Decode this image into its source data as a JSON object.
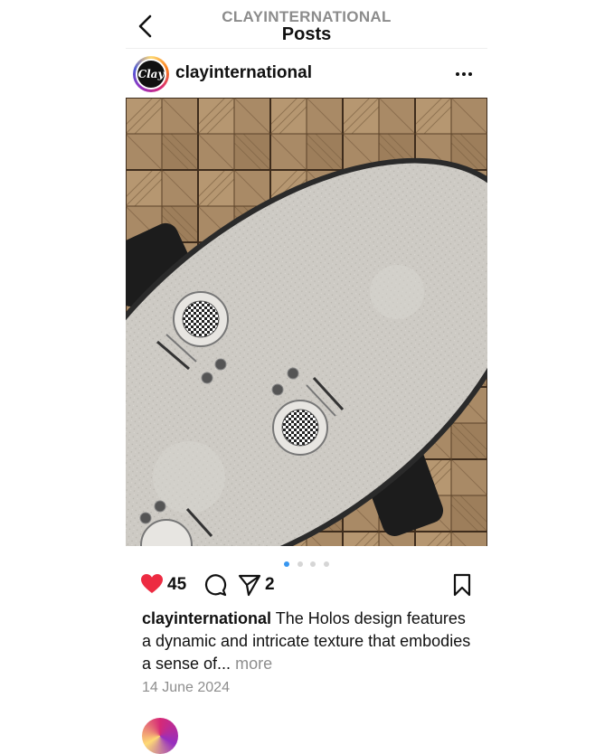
{
  "header": {
    "account": "CLAYINTERNATIONAL",
    "title": "Posts"
  },
  "post": {
    "avatar_text": "Clay",
    "username": "clayinternational",
    "media": {
      "image_index": 1,
      "image_count": 4,
      "description": "overhead view of oval table with place settings on parquet floor"
    },
    "likes": "45",
    "shares": "2",
    "caption_user": "clayinternational",
    "caption_text": "The Holos design features a dynamic and intricate texture that embodies a sense of...",
    "more_label": "more",
    "date": "14 June 2024"
  },
  "icons": {
    "back": "chevron-left-icon",
    "more": "ellipsis-icon",
    "like": "heart-icon",
    "comment": "comment-icon",
    "share": "paper-plane-icon",
    "save": "bookmark-icon"
  },
  "colors": {
    "like": "#ed2b42",
    "active_dot": "#3897f0",
    "muted_text": "#8e8e8e",
    "header_account": "#8c8c8c"
  }
}
